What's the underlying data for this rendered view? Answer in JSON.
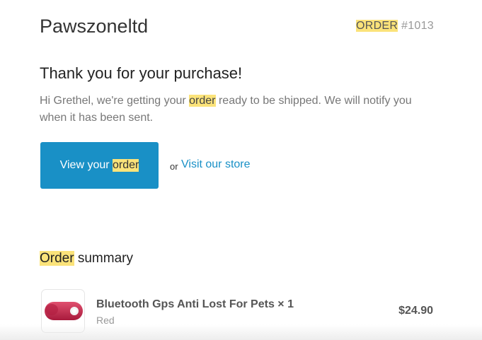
{
  "header": {
    "shop_name": "Pawszoneltd",
    "order_word": "ORDER",
    "order_number": "#1013"
  },
  "confirmation": {
    "title": "Thank you for your purchase!",
    "message_before": "Hi Grethel, we're getting your ",
    "message_highlight": "order",
    "message_after": " ready to be shipped. We will notify you when it has been sent."
  },
  "actions": {
    "view_label_before": "View your ",
    "view_label_highlight": "order",
    "or_text": "or",
    "store_link_label": "Visit our store"
  },
  "summary": {
    "title_highlight": "Order",
    "title_rest": " summary",
    "items": [
      {
        "name": "Bluetooth Gps Anti Lost For Pets × 1",
        "variant": "Red",
        "price": "$24.90"
      }
    ]
  },
  "colors": {
    "accent": "#1990c6",
    "highlight": "#fbe37a",
    "product_tag": "#c8234a"
  }
}
